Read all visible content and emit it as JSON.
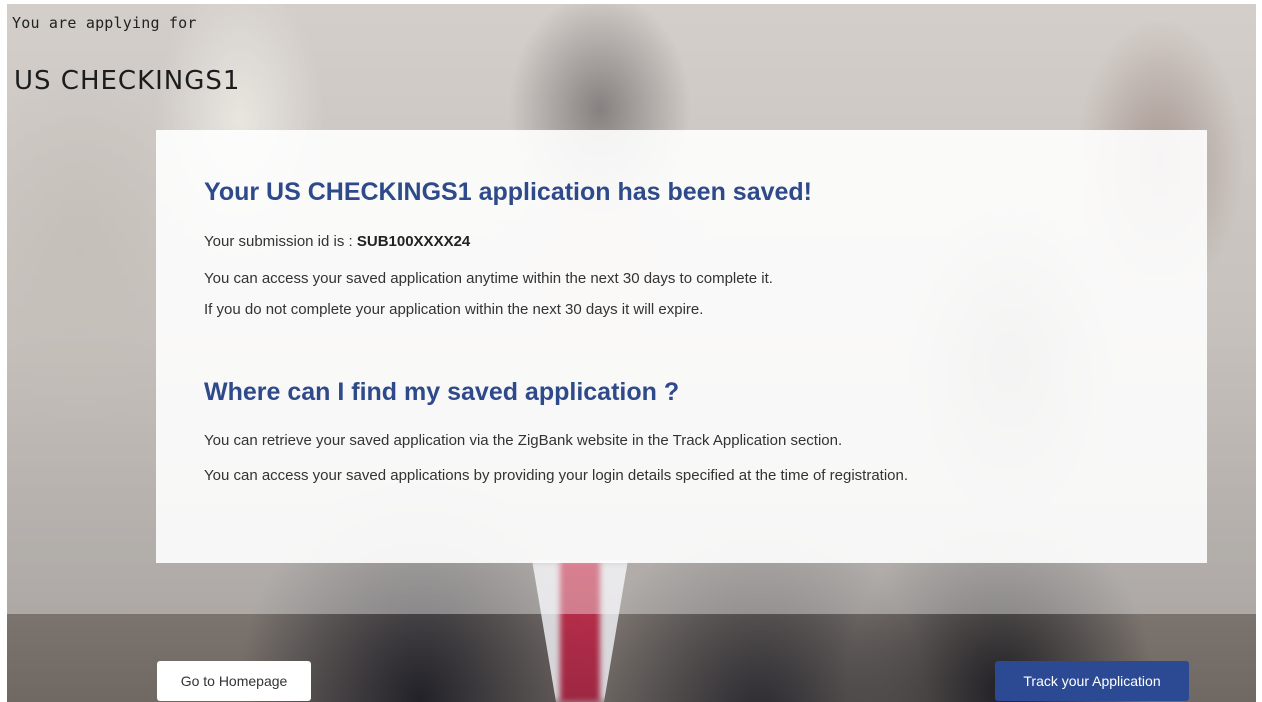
{
  "header": {
    "applying_label": "You are applying for",
    "product_name": "US CHECKINGS1"
  },
  "confirmation": {
    "title": "Your US CHECKINGS1 application has been saved!",
    "submission_prefix": "Your submission id is : ",
    "submission_id": "SUB100XXXX24",
    "access_note": "You can access your saved application anytime within the next 30 days to complete it.",
    "expiry_note": "If you do not complete your application within the next 30 days it will expire."
  },
  "find_section": {
    "title": "Where can I find my saved application ?",
    "retrieve_note": "You can retrieve your saved application via the ZigBank website in the Track Application section.",
    "login_note": "You can access your saved applications by providing your login details specified at the time of registration."
  },
  "actions": {
    "home_label": "Go to Homepage",
    "track_label": "Track your Application"
  },
  "colors": {
    "heading": "#2f4a8a",
    "primary_button": "#2c4a93"
  }
}
